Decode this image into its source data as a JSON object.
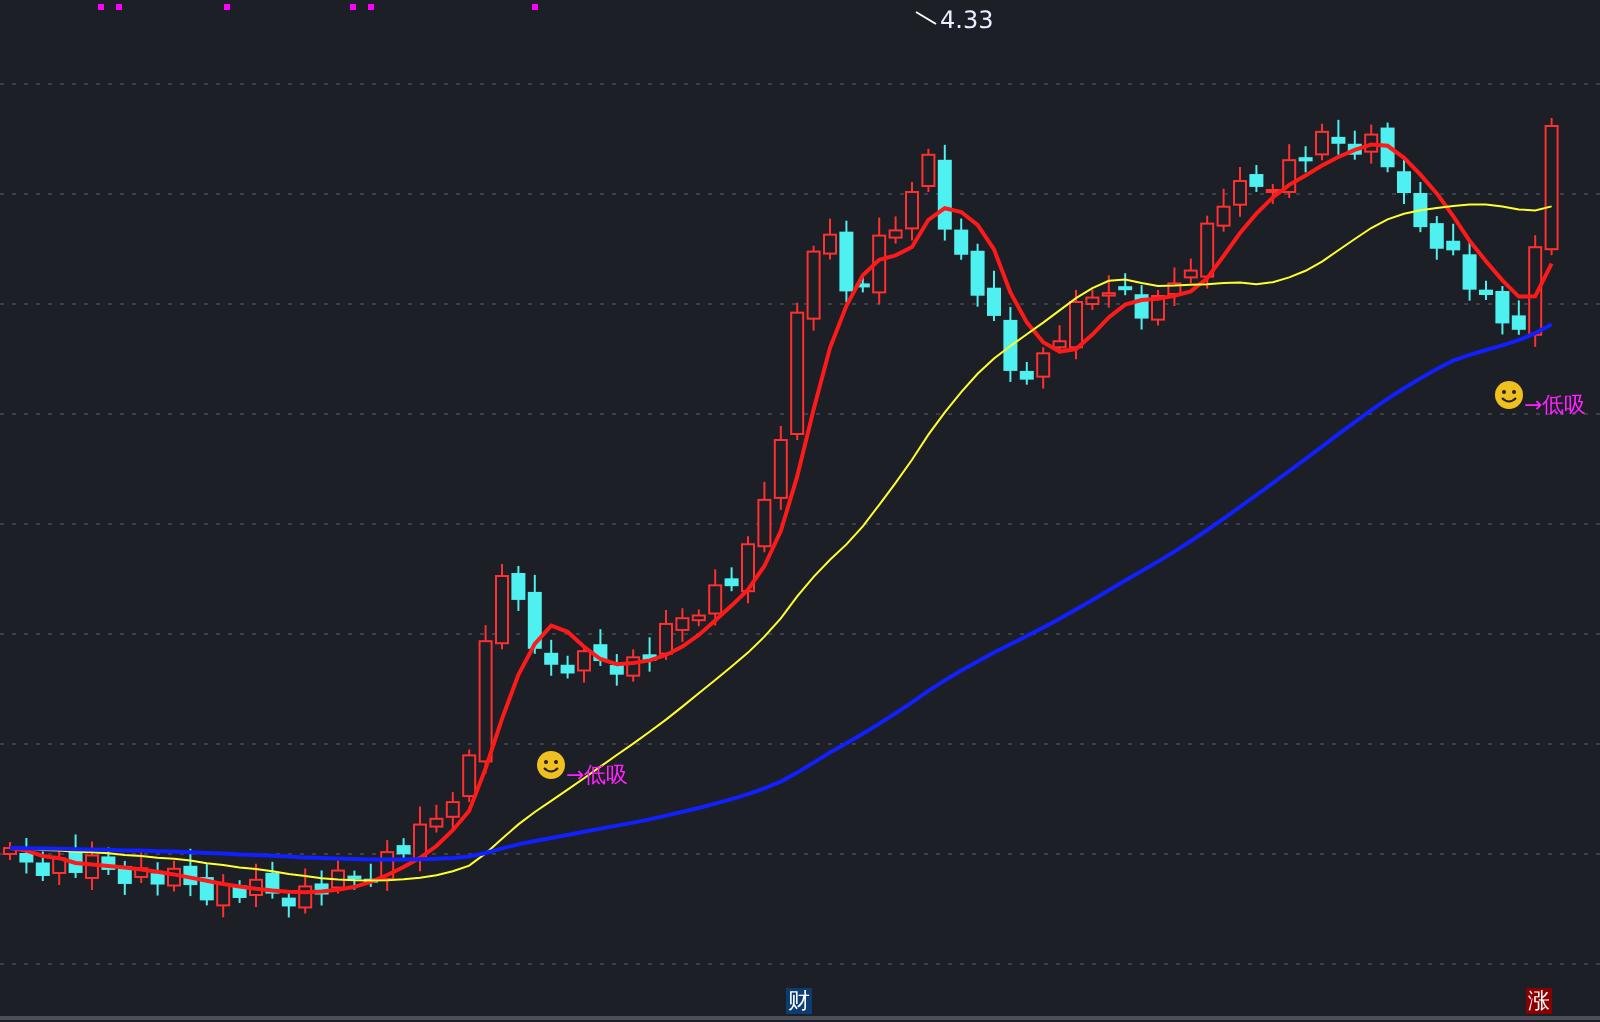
{
  "chart": {
    "high_label": "4.33",
    "signals": [
      {
        "text": "→低吸"
      },
      {
        "text": "→低吸"
      }
    ],
    "markers": [
      {
        "text": "财",
        "kind": "finance"
      },
      {
        "text": "涨",
        "kind": "rise"
      }
    ]
  }
}
